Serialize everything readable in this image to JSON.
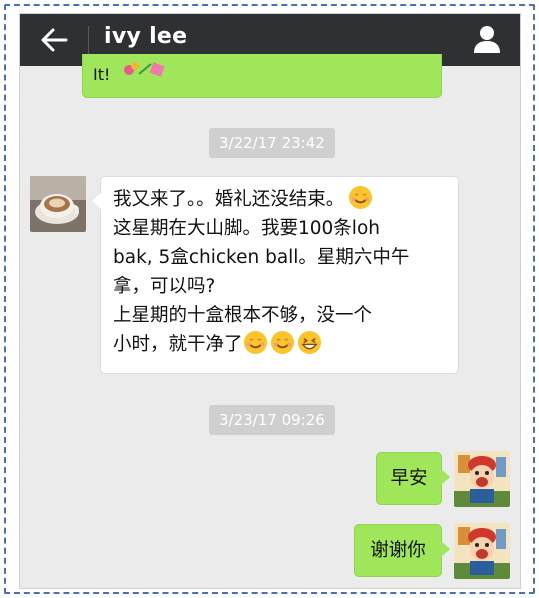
{
  "header": {
    "title": "ivy lee",
    "back_icon": "arrow-left-icon",
    "profile_icon": "person-icon"
  },
  "messages": {
    "top_partial": {
      "text": "It!"
    },
    "stamp1": "3/22/17 23:42",
    "incoming": {
      "line1": "我又来了。。婚礼还没结束。",
      "line2": "这星期在大山脚。我要100条loh",
      "line3": "bak, 5盒chicken ball。星期六中午",
      "line4": "拿，可以吗?",
      "line5": " 上星期的十盒根本不够，没一个",
      "line6": "小时，就干净了"
    },
    "stamp2": "3/23/17 09:26",
    "outgoing1": "早安",
    "outgoing2": "谢谢你"
  },
  "colors": {
    "header_bg": "#2f3034",
    "chat_bg": "#ebebeb",
    "outgoing_bubble": "#9fe65a",
    "incoming_bubble": "#ffffff",
    "timestamp_bg": "#cfcfcf",
    "frame_border": "#4a6fb5"
  }
}
